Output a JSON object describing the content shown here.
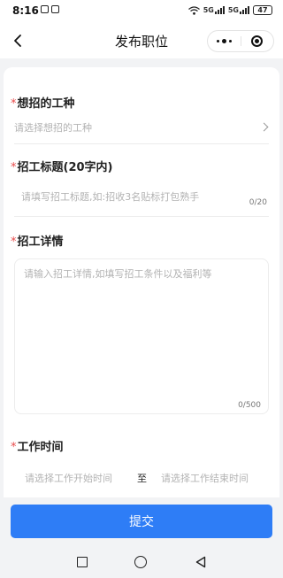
{
  "status_bar": {
    "time": "8:16",
    "signal_1": "5G",
    "signal_2": "5G",
    "battery": "47"
  },
  "nav": {
    "title": "发布职位",
    "back_icon": "chevron-left-icon",
    "more_icon": "more-dots-icon",
    "close_icon": "target-circle-icon"
  },
  "form": {
    "work_type": {
      "required_mark": "*",
      "label": "想招的工种",
      "placeholder": "请选择想招的工种"
    },
    "title": {
      "required_mark": "*",
      "label": "招工标题(20字内)",
      "placeholder": "请填写招工标题,如:招收3名贴标打包熟手",
      "counter": "0/20"
    },
    "details": {
      "required_mark": "*",
      "label": "招工详情",
      "placeholder": "请输入招工详情,如填写招工条件以及福利等",
      "counter": "0/500"
    },
    "work_time": {
      "required_mark": "*",
      "label": "工作时间",
      "start_placeholder": "请选择工作开始时间",
      "separator": "至",
      "end_placeholder": "请选择工作结束时间"
    }
  },
  "submit_label": "提交",
  "colors": {
    "primary": "#2e7df6",
    "required": "#e84a4a",
    "background": "#f2f3f5"
  }
}
